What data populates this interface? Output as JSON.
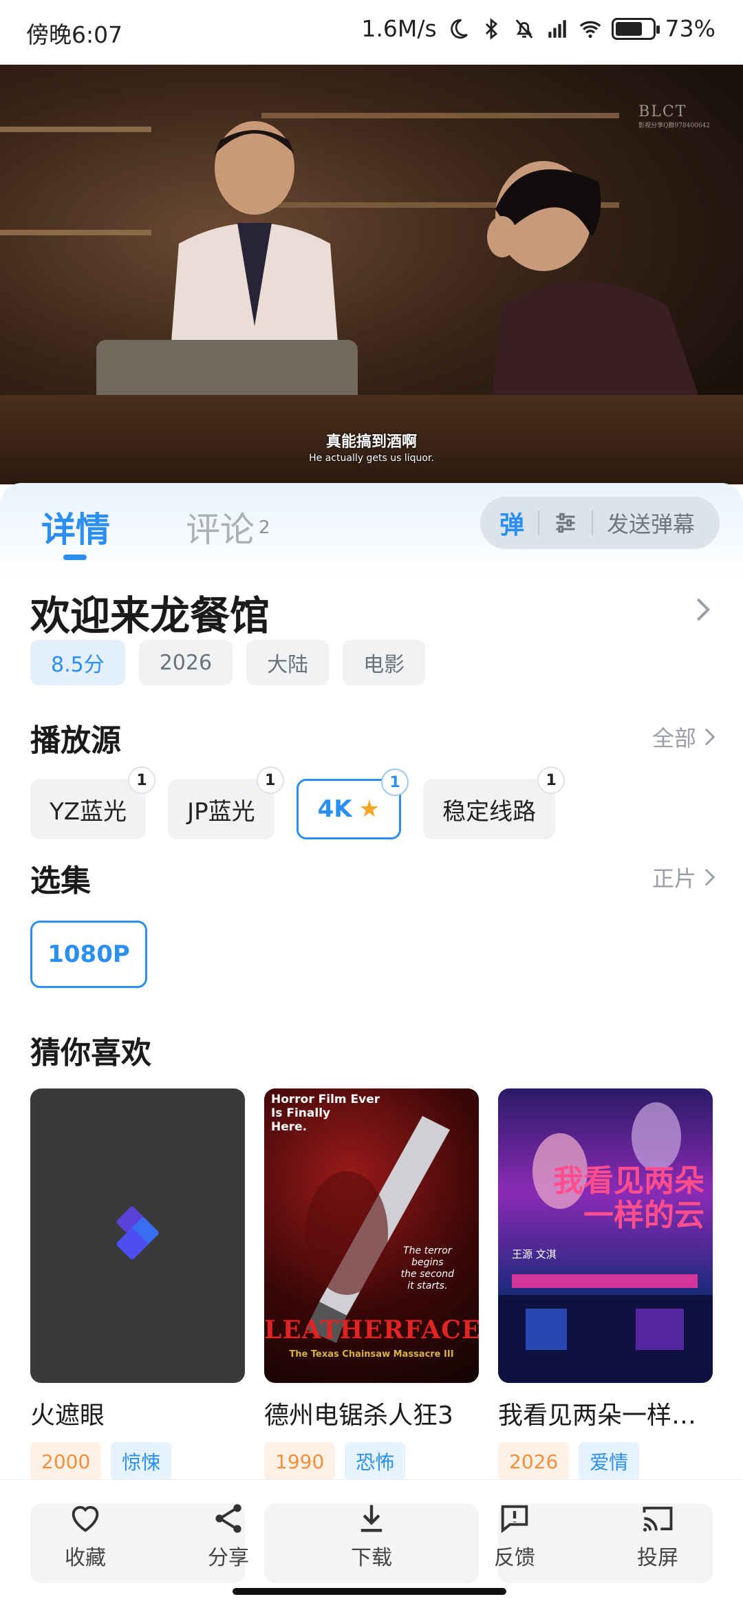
{
  "status_bar": {
    "time": "傍晚6:07",
    "net_speed": "1.6M/s",
    "battery": "73%",
    "battery_level": 0.73,
    "icons": [
      "moon-icon",
      "bluetooth-icon",
      "mute-icon",
      "signal-icon",
      "wifi-icon",
      "battery-icon"
    ]
  },
  "video": {
    "subtitle_cn": "真能搞到酒啊",
    "subtitle_en": "He actually gets us liquor.",
    "watermark": "BLCT",
    "watermark_sub": "影视分享Q群978400642"
  },
  "tabs": {
    "detail": "详情",
    "comment": "评论",
    "comment_count": "2"
  },
  "danmaku": {
    "toggle": "弹",
    "send": "发送弹幕"
  },
  "movie": {
    "title": "欢迎来龙餐馆",
    "tags": [
      "8.5分",
      "2026",
      "大陆",
      "电影"
    ]
  },
  "sources": {
    "title": "播放源",
    "more": "全部",
    "items": [
      {
        "label": "YZ蓝光",
        "count": "1"
      },
      {
        "label": "JP蓝光",
        "count": "1"
      },
      {
        "label": "4K",
        "count": "1",
        "active": true
      },
      {
        "label": "稳定线路",
        "count": "1"
      }
    ]
  },
  "episodes": {
    "title": "选集",
    "more": "正片",
    "items": [
      "1080P"
    ]
  },
  "recommend": {
    "title": "猜你喜欢",
    "items": [
      {
        "name": "火遮眼",
        "year": "2000",
        "genre": "惊悚"
      },
      {
        "name": "德州电锯杀人狂3",
        "year": "1990",
        "genre": "恐怖",
        "poster_text": "Horror Film Ever\nIs Finally\nHere.",
        "poster_title": "LEATHERFACE",
        "poster_sub": "The Texas Chainsaw Massacre III",
        "poster_tagline": "The terror\nbegins\nthe second\nit starts."
      },
      {
        "name": "我看见两朵一样的云",
        "year": "2026",
        "genre": "爱情",
        "poster_title": "我看见两朵\n一样的云",
        "poster_names": "王源  文淇"
      }
    ]
  },
  "bottom_bar": {
    "favorite": "收藏",
    "share": "分享",
    "download": "下载",
    "feedback": "反馈",
    "cast": "投屏"
  },
  "colors": {
    "accent": "#2a8ff0",
    "year_tag": "#f0903a",
    "star": "#f5a623"
  }
}
